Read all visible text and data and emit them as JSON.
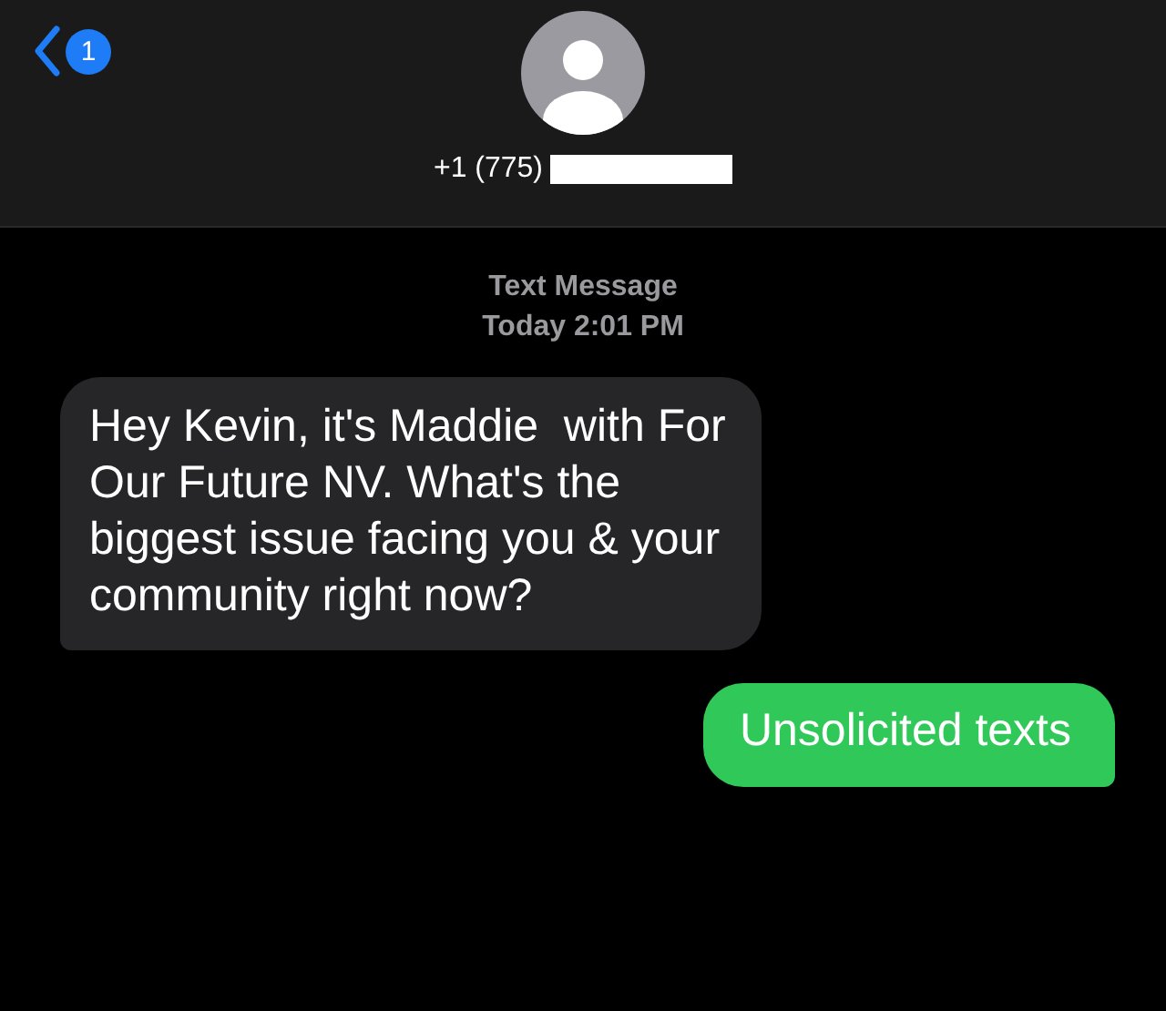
{
  "header": {
    "back_badge": "1",
    "contact": "+1 (775)"
  },
  "thread_info": {
    "service": "Text Message",
    "timestamp": "Today 2:01 PM"
  },
  "messages": [
    {
      "kind": "incoming",
      "text": "Hey Kevin, it's Maddie  with For\nOur Future NV. What's the\nbiggest issue facing you & your\ncommunity right now?"
    },
    {
      "kind": "outgoing",
      "text": "Unsolicited texts"
    }
  ]
}
